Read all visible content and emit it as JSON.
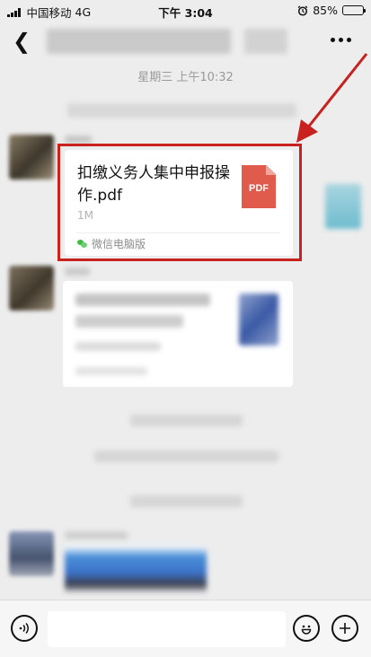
{
  "status_bar": {
    "carrier": "中国移动",
    "network": "4G",
    "time": "下午 3:04",
    "battery": "85%",
    "battery_level": 0.85
  },
  "chat": {
    "timestamp": "星期三 上午10:32"
  },
  "file_message": {
    "file_name": "扣缴义务人集中申报操作.pdf",
    "file_size": "1M",
    "file_type": "PDF",
    "source": "微信电脑版"
  },
  "icons": {
    "back": "back-arrow-icon",
    "more": "more-dots-icon",
    "voice": "voice-icon",
    "emoji": "emoji-icon",
    "add": "plus-icon",
    "alarm": "alarm-icon"
  },
  "colors": {
    "highlight": "#c8211e",
    "pdf_red": "#e05b4b",
    "wechat_green": "#3dbb45",
    "background": "#ededed"
  }
}
